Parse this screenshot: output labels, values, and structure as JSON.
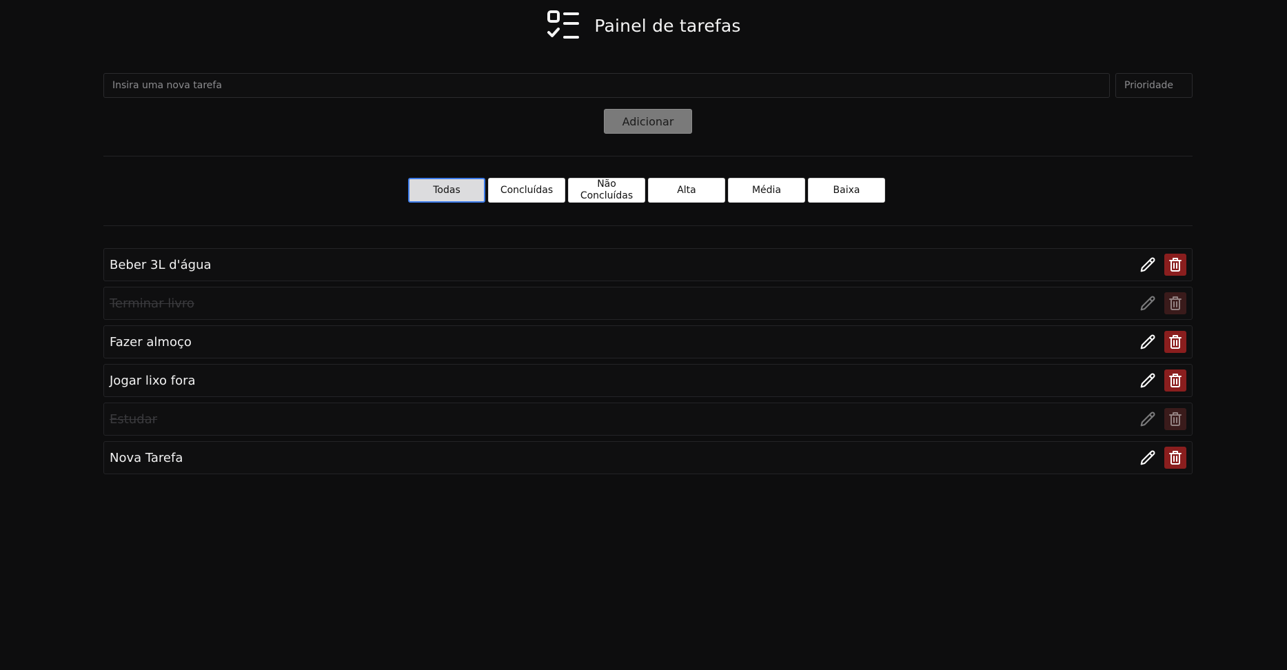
{
  "header": {
    "title": "Painel de tarefas",
    "icon": "checklist-icon"
  },
  "form": {
    "task_placeholder": "Insira uma nova tarefa",
    "task_value": "",
    "priority_placeholder": "Prioridade",
    "priority_value": "",
    "add_label": "Adicionar"
  },
  "filters": [
    {
      "label": "Todas",
      "active": true
    },
    {
      "label": "Concluídas",
      "active": false
    },
    {
      "label": "Não Concluídas",
      "active": false
    },
    {
      "label": "Alta",
      "active": false
    },
    {
      "label": "Média",
      "active": false
    },
    {
      "label": "Baixa",
      "active": false
    }
  ],
  "tasks": [
    {
      "text": "Beber 3L d'água",
      "done": false
    },
    {
      "text": "Terminar livro",
      "done": true
    },
    {
      "text": "Fazer almoço",
      "done": false
    },
    {
      "text": "Jogar lixo fora",
      "done": false
    },
    {
      "text": "Estudar",
      "done": true
    },
    {
      "text": "Nova Tarefa",
      "done": false
    }
  ],
  "icons": {
    "edit": "pencil-icon",
    "delete": "trash-icon"
  },
  "colors": {
    "background": "#0d0d0e",
    "delete_button": "#8a1e1e",
    "active_filter_border": "#3d7be8"
  }
}
